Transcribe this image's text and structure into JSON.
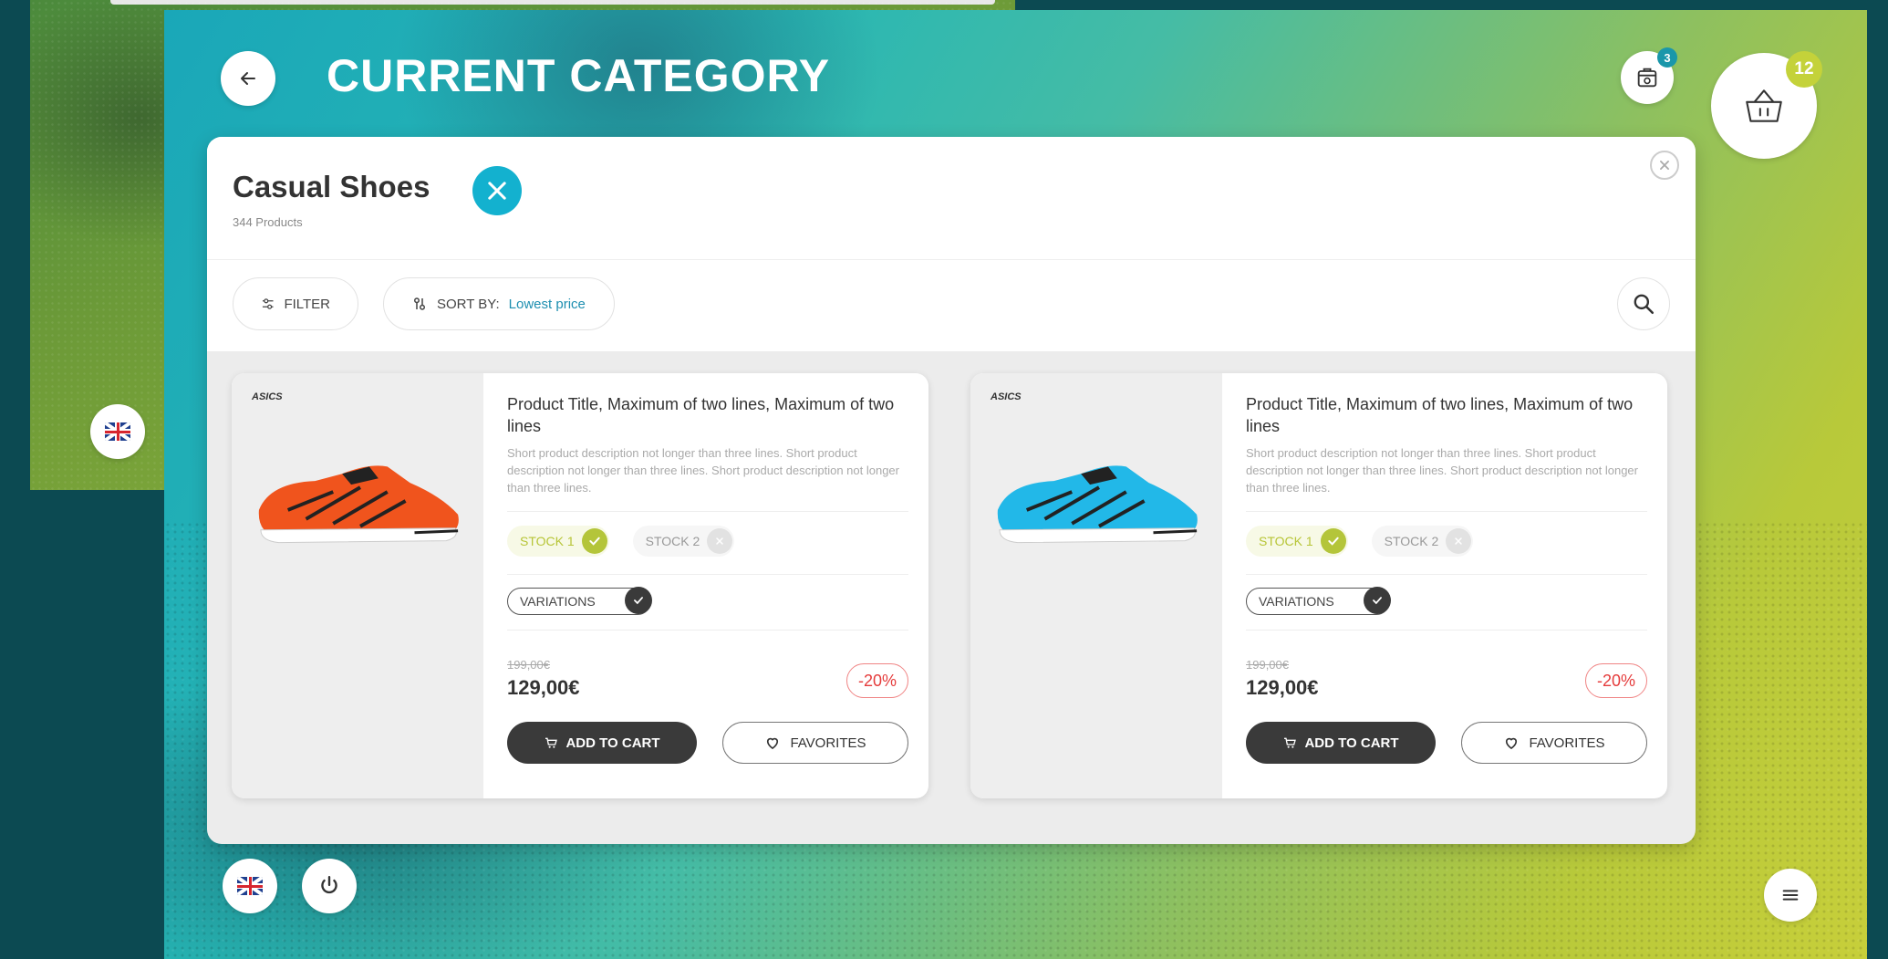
{
  "header": {
    "title": "CURRENT CATEGORY",
    "orders_count": "3",
    "cart_count": "12"
  },
  "category": {
    "name": "Casual Shoes",
    "product_count": "344 Products"
  },
  "toolbar": {
    "filter_label": "FILTER",
    "sort_label": "SORT BY:",
    "sort_value": "Lowest price"
  },
  "products": [
    {
      "brand": "ASICS",
      "title": "Product Title, Maximum of two lines, Maximum of two lines",
      "description": "Short product description not longer than three lines. Short product description not longer than three lines. Short product description not longer than three lines.",
      "stock1": "STOCK 1",
      "stock2": "STOCK 2",
      "variations": "VARIATIONS",
      "old_price": "199,00€",
      "price": "129,00€",
      "discount": "-20%",
      "add_to_cart": "ADD TO CART",
      "favorites": "FAVORITES",
      "color": "#f0541d"
    },
    {
      "brand": "ASICS",
      "title": "Product Title, Maximum of two lines, Maximum of two lines",
      "description": "Short product description not longer than three lines. Short product description not longer than three lines. Short product description not longer than three lines.",
      "stock1": "STOCK 1",
      "stock2": "STOCK 2",
      "variations": "VARIATIONS",
      "old_price": "199,00€",
      "price": "129,00€",
      "discount": "-20%",
      "add_to_cart": "ADD TO CART",
      "favorites": "FAVORITES",
      "color": "#22b8e8"
    }
  ],
  "icons": {
    "back": "arrow-left-icon",
    "orders": "orders-icon",
    "cart": "basket-icon",
    "clear": "close-icon",
    "search": "search-icon",
    "language": "uk-flag-icon",
    "power": "power-icon",
    "menu": "menu-icon"
  },
  "colors": {
    "accent": "#13b1cf",
    "stock_ok": "#b4c53a",
    "discount": "#e53c3c",
    "dark_button": "#3a3a3a"
  }
}
